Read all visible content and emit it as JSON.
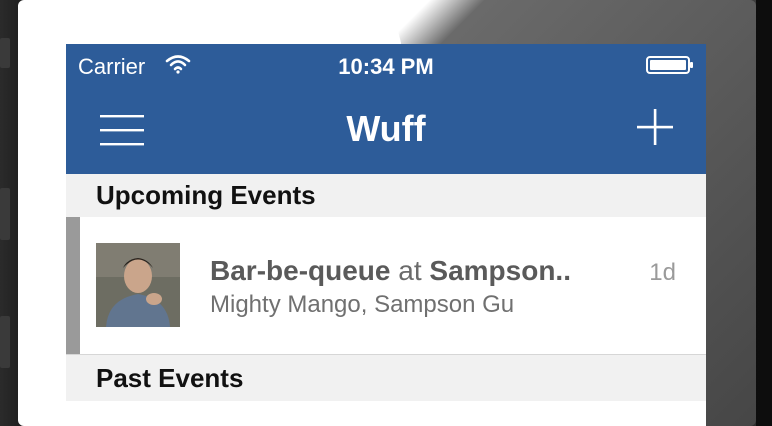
{
  "status_bar": {
    "carrier": "Carrier",
    "time": "10:34 PM"
  },
  "nav_bar": {
    "title": "Wuff",
    "left_icon": "hamburger-menu-icon",
    "right_icon": "plus-icon"
  },
  "sections": {
    "upcoming": {
      "header": "Upcoming Events",
      "events": [
        {
          "title_bold_1": "Bar-be-queue",
          "title_connector": " at ",
          "title_bold_2": "Sampson..",
          "subtitle": "Mighty Mango, Sampson Gu",
          "age": "1d"
        }
      ]
    },
    "past": {
      "header": "Past Events"
    }
  },
  "colors": {
    "nav_blue": "#2d5c99",
    "section_bg": "#f1f1f1",
    "row_accent": "#9a9a9a"
  }
}
